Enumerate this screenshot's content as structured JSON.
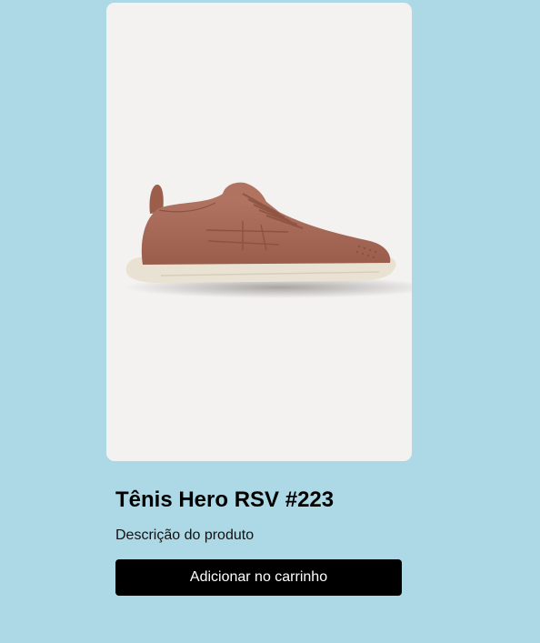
{
  "product": {
    "image_alt": "sneaker-image",
    "name": "Tênis Hero RSV #223",
    "description": "Descrição do produto",
    "add_to_cart_label": "Adicionar no carrinho"
  },
  "colors": {
    "page_background": "#add8e6",
    "image_background": "#f3f2f1",
    "button_background": "#000000",
    "button_text": "#ffffff",
    "shoe_upper": "#a86a56",
    "shoe_sole": "#e9e2d3"
  }
}
